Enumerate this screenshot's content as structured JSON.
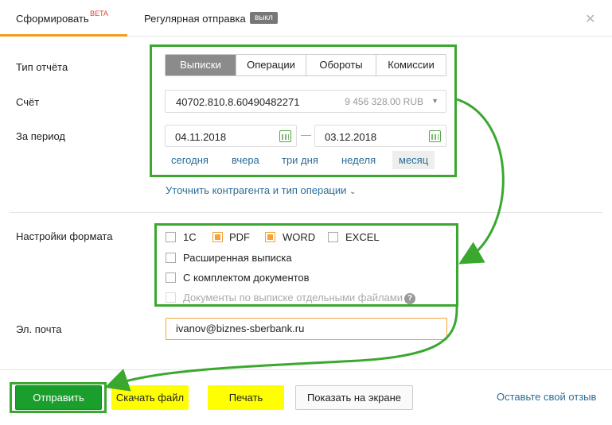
{
  "tabs": {
    "form_label": "Сформировать",
    "beta": "BETA",
    "regular_label": "Регулярная отправка",
    "regular_badge": "выкл"
  },
  "labels": {
    "report_type": "Тип отчёта",
    "account": "Счёт",
    "period": "За период",
    "format": "Настройки формата",
    "email": "Эл. почта"
  },
  "report_types": [
    "Выписки",
    "Операции",
    "Обороты",
    "Комиссии"
  ],
  "selected_report_type": "Выписки",
  "account": {
    "number": "40702.810.8.60490482271",
    "balance": "9 456 328.00 RUB"
  },
  "period": {
    "from": "04.11.2018",
    "to": "03.12.2018",
    "separator": "—"
  },
  "quick_ranges": [
    "сегодня",
    "вчера",
    "три дня",
    "неделя",
    "месяц"
  ],
  "active_quick_range": "месяц",
  "refine_link": "Уточнить контрагента и тип операции",
  "formats": [
    {
      "label": "1С",
      "checked": false
    },
    {
      "label": "PDF",
      "checked": true
    },
    {
      "label": "WORD",
      "checked": true
    },
    {
      "label": "EXCEL",
      "checked": false
    }
  ],
  "options": [
    {
      "label": "Расширенная выписка",
      "checked": false,
      "disabled": false
    },
    {
      "label": "С комплектом документов",
      "checked": false,
      "disabled": false
    },
    {
      "label": "Документы по выписке отдельными файлами",
      "checked": false,
      "disabled": true
    }
  ],
  "help_glyph": "?",
  "email_value": "ivanov@biznes-sberbank.ru",
  "buttons": {
    "send": "Отправить",
    "download": "Скачать файл",
    "print": "Печать",
    "show": "Показать на экране"
  },
  "feedback_link": "Оставьте свой отзыв",
  "colors": {
    "accent_orange": "#f39c1a",
    "send_green": "#1a9e2c",
    "highlight_yellow": "#ffff00",
    "annotation_green": "#3aa82f",
    "link_blue": "#2a6e96"
  }
}
